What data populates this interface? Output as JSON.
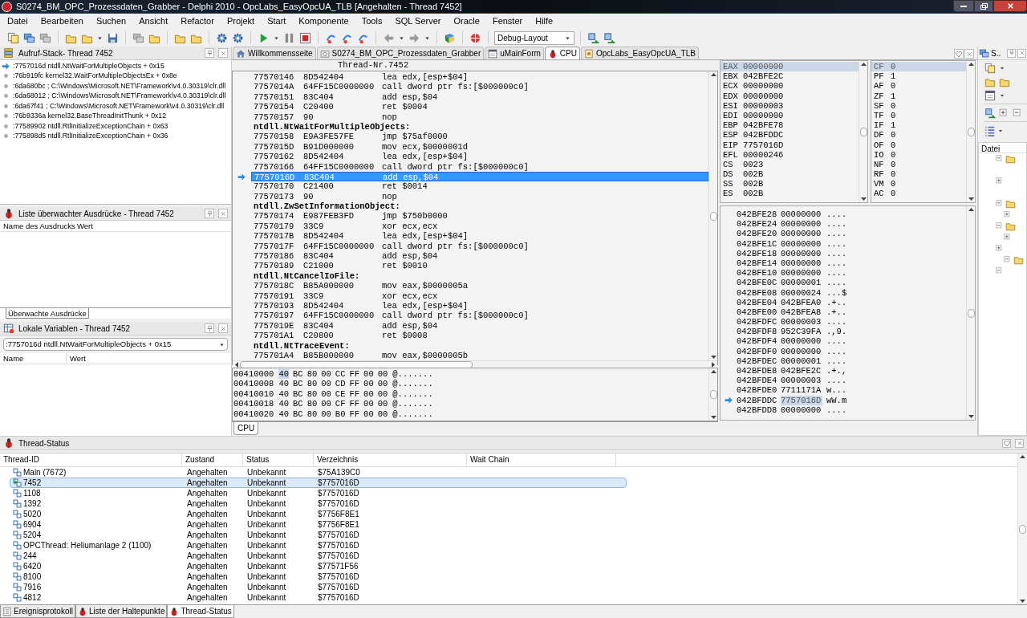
{
  "window": {
    "title": "S0274_BM_OPC_Prozessdaten_Grabber - Delphi 2010 - OpcLabs_EasyOpcUA_TLB [Angehalten - Thread 7452]"
  },
  "menu": [
    "Datei",
    "Bearbeiten",
    "Suchen",
    "Ansicht",
    "Refactor",
    "Projekt",
    "Start",
    "Komponente",
    "Tools",
    "SQL Server",
    "Oracle",
    "Fenster",
    "Hilfe"
  ],
  "toolbar": {
    "layout_select": "Debug-Layout"
  },
  "call_stack": {
    "title": "Aufruf-Stack- Thread 7452",
    "frames": [
      {
        "text": ":7757016d ntdll.NtWaitForMultipleObjects + 0x15",
        "current": true
      },
      {
        "text": ":76b919fc kernel32.WaitForMultipleObjectsEx + 0x8e",
        "current": false
      },
      {
        "text": ":6da680bc ; C:\\Windows\\Microsoft.NET\\Framework\\v4.0.30319\\clr.dll",
        "current": false
      },
      {
        "text": ":6da68012 ; C:\\Windows\\Microsoft.NET\\Framework\\v4.0.30319\\clr.dll",
        "current": false
      },
      {
        "text": ":6da67f41 ; C:\\Windows\\Microsoft.NET\\Framework\\v4.0.30319\\clr.dll",
        "current": false
      },
      {
        "text": ":76b9336a kernel32.BaseThreadInitThunk + 0x12",
        "current": false
      },
      {
        "text": ":77589902 ntdll.RtlInitializeExceptionChain + 0x63",
        "current": false
      },
      {
        "text": ":775898d5 ntdll.RtlInitializeExceptionChain + 0x36",
        "current": false
      }
    ]
  },
  "watches": {
    "title": "Liste überwachter Ausdrücke - Thread 7452",
    "columns": [
      "Name des Ausdrucks",
      "Wert"
    ],
    "tab": "Überwachte Ausdrücke"
  },
  "locals": {
    "title": "Lokale Variablen - Thread 7452",
    "frame": ":7757016d ntdll.NtWaitForMultipleObjects + 0x15",
    "columns": [
      "Name",
      "Wert"
    ]
  },
  "editor_tabs": [
    {
      "label": "Willkommensseite",
      "selected": false
    },
    {
      "label": "S0274_BM_OPC_Prozessdaten_Grabber",
      "selected": false
    },
    {
      "label": "uMainForm",
      "selected": false
    },
    {
      "label": "CPU",
      "selected": true
    },
    {
      "label": "OpcLabs_EasyOpcUA_TLB",
      "selected": false
    }
  ],
  "cpu": {
    "thread_label": "Thread-Nr.7452",
    "disassembly": [
      {
        "kind": "instr",
        "address": "77570146",
        "bytes": "8D542404",
        "asm": "lea edx,[esp+$04]",
        "current": false
      },
      {
        "kind": "instr",
        "address": "7757014A",
        "bytes": "64FF15C0000000",
        "asm": "call dword ptr fs:[$000000c0]",
        "current": false
      },
      {
        "kind": "instr",
        "address": "77570151",
        "bytes": "83C404",
        "asm": "add esp,$04",
        "current": false
      },
      {
        "kind": "instr",
        "address": "77570154",
        "bytes": "C20400",
        "asm": "ret $0004",
        "current": false
      },
      {
        "kind": "instr",
        "address": "77570157",
        "bytes": "90",
        "asm": "nop",
        "current": false
      },
      {
        "kind": "label",
        "text": "ntdll.NtWaitForMultipleObjects:"
      },
      {
        "kind": "instr",
        "address": "77570158",
        "bytes": "E9A3FE57FE",
        "asm": "jmp $75af0000",
        "current": false
      },
      {
        "kind": "instr",
        "address": "7757015D",
        "bytes": "B91D000000",
        "asm": "mov ecx,$0000001d",
        "current": false
      },
      {
        "kind": "instr",
        "address": "77570162",
        "bytes": "8D542404",
        "asm": "lea edx,[esp+$04]",
        "current": false
      },
      {
        "kind": "instr",
        "address": "77570166",
        "bytes": "64FF15C0000000",
        "asm": "call dword ptr fs:[$000000c0]",
        "current": false
      },
      {
        "kind": "instr",
        "address": "7757016D",
        "bytes": "83C404",
        "asm": "add esp,$04",
        "current": true
      },
      {
        "kind": "instr",
        "address": "77570170",
        "bytes": "C21400",
        "asm": "ret $0014",
        "current": false
      },
      {
        "kind": "instr",
        "address": "77570173",
        "bytes": "90",
        "asm": "nop",
        "current": false
      },
      {
        "kind": "label",
        "text": "ntdll.ZwSetInformationObject:"
      },
      {
        "kind": "instr",
        "address": "77570174",
        "bytes": "E987FEB3FD",
        "asm": "jmp $750b0000",
        "current": false
      },
      {
        "kind": "instr",
        "address": "77570179",
        "bytes": "33C9",
        "asm": "xor ecx,ecx",
        "current": false
      },
      {
        "kind": "instr",
        "address": "7757017B",
        "bytes": "8D542404",
        "asm": "lea edx,[esp+$04]",
        "current": false
      },
      {
        "kind": "instr",
        "address": "7757017F",
        "bytes": "64FF15C0000000",
        "asm": "call dword ptr fs:[$000000c0]",
        "current": false
      },
      {
        "kind": "instr",
        "address": "77570186",
        "bytes": "83C404",
        "asm": "add esp,$04",
        "current": false
      },
      {
        "kind": "instr",
        "address": "77570189",
        "bytes": "C21000",
        "asm": "ret $0010",
        "current": false
      },
      {
        "kind": "label",
        "text": "ntdll.NtCancelIoFile:"
      },
      {
        "kind": "instr",
        "address": "7757018C",
        "bytes": "B85A000000",
        "asm": "mov eax,$0000005a",
        "current": false
      },
      {
        "kind": "instr",
        "address": "77570191",
        "bytes": "33C9",
        "asm": "xor ecx,ecx",
        "current": false
      },
      {
        "kind": "instr",
        "address": "77570193",
        "bytes": "8D542404",
        "asm": "lea edx,[esp+$04]",
        "current": false
      },
      {
        "kind": "instr",
        "address": "77570197",
        "bytes": "64FF15C0000000",
        "asm": "call dword ptr fs:[$000000c0]",
        "current": false
      },
      {
        "kind": "instr",
        "address": "7757019E",
        "bytes": "83C404",
        "asm": "add esp,$04",
        "current": false
      },
      {
        "kind": "instr",
        "address": "775701A1",
        "bytes": "C20800",
        "asm": "ret $0008",
        "current": false
      },
      {
        "kind": "label",
        "text": "ntdll.NtTraceEvent:"
      },
      {
        "kind": "instr",
        "address": "775701A4",
        "bytes": "B85B000000",
        "asm": "mov eax,$0000005b",
        "current": false
      }
    ],
    "registers": [
      {
        "name": "EAX",
        "value": "00000000",
        "selected": true
      },
      {
        "name": "EBX",
        "value": "042BFE2C",
        "selected": false
      },
      {
        "name": "ECX",
        "value": "00000000",
        "selected": false
      },
      {
        "name": "EDX",
        "value": "00000000",
        "selected": false
      },
      {
        "name": "ESI",
        "value": "00000003",
        "selected": false
      },
      {
        "name": "EDI",
        "value": "00000000",
        "selected": false
      },
      {
        "name": "EBP",
        "value": "042BFE78",
        "selected": false
      },
      {
        "name": "ESP",
        "value": "042BFDDC",
        "selected": false
      },
      {
        "name": "EIP",
        "value": "7757016D",
        "selected": false
      },
      {
        "name": "EFL",
        "value": "00000246",
        "selected": false
      },
      {
        "name": "CS",
        "value": "0023",
        "selected": false
      },
      {
        "name": "DS",
        "value": "002B",
        "selected": false
      },
      {
        "name": "SS",
        "value": "002B",
        "selected": false
      },
      {
        "name": "ES",
        "value": "002B",
        "selected": false
      }
    ],
    "flags": [
      {
        "name": "CF",
        "value": "0",
        "selected": true
      },
      {
        "name": "PF",
        "value": "1",
        "selected": false
      },
      {
        "name": "AF",
        "value": "0",
        "selected": false
      },
      {
        "name": "ZF",
        "value": "1",
        "selected": false
      },
      {
        "name": "SF",
        "value": "0",
        "selected": false
      },
      {
        "name": "TF",
        "value": "0",
        "selected": false
      },
      {
        "name": "IF",
        "value": "1",
        "selected": false
      },
      {
        "name": "DF",
        "value": "0",
        "selected": false
      },
      {
        "name": "OF",
        "value": "0",
        "selected": false
      },
      {
        "name": "IO",
        "value": "0",
        "selected": false
      },
      {
        "name": "NF",
        "value": "0",
        "selected": false
      },
      {
        "name": "RF",
        "value": "0",
        "selected": false
      },
      {
        "name": "VM",
        "value": "0",
        "selected": false
      },
      {
        "name": "AC",
        "value": "0",
        "selected": false
      }
    ],
    "stack": [
      {
        "address": "042BFE28",
        "value": "00000000",
        "ascii": "....",
        "current": false
      },
      {
        "address": "042BFE24",
        "value": "00000000",
        "ascii": "....",
        "current": false
      },
      {
        "address": "042BFE20",
        "value": "00000000",
        "ascii": "....",
        "current": false
      },
      {
        "address": "042BFE1C",
        "value": "00000000",
        "ascii": "....",
        "current": false
      },
      {
        "address": "042BFE18",
        "value": "00000000",
        "ascii": "....",
        "current": false
      },
      {
        "address": "042BFE14",
        "value": "00000000",
        "ascii": "....",
        "current": false
      },
      {
        "address": "042BFE10",
        "value": "00000000",
        "ascii": "....",
        "current": false
      },
      {
        "address": "042BFE0C",
        "value": "00000001",
        "ascii": "....",
        "current": false
      },
      {
        "address": "042BFE08",
        "value": "00000024",
        "ascii": "...$",
        "current": false
      },
      {
        "address": "042BFE04",
        "value": "042BFEA0",
        "ascii": ".+..",
        "current": false
      },
      {
        "address": "042BFE00",
        "value": "042BFEA8",
        "ascii": ".+..",
        "current": false
      },
      {
        "address": "042BFDFC",
        "value": "00000003",
        "ascii": "....",
        "current": false
      },
      {
        "address": "042BFDF8",
        "value": "952C39FA",
        "ascii": ".,9.",
        "current": false
      },
      {
        "address": "042BFDF4",
        "value": "00000000",
        "ascii": "....",
        "current": false
      },
      {
        "address": "042BFDF0",
        "value": "00000000",
        "ascii": "....",
        "current": false
      },
      {
        "address": "042BFDEC",
        "value": "00000001",
        "ascii": "....",
        "current": false
      },
      {
        "address": "042BFDE8",
        "value": "042BFE2C",
        "ascii": ".+.,",
        "current": false
      },
      {
        "address": "042BFDE4",
        "value": "00000003",
        "ascii": "....",
        "current": false
      },
      {
        "address": "042BFDE0",
        "value": "7711171A",
        "ascii": "w...",
        "current": false
      },
      {
        "address": "042BFDDC",
        "value": "7757016D",
        "ascii": "wW.m",
        "current": true
      },
      {
        "address": "042BFDD8",
        "value": "00000000",
        "ascii": "....",
        "current": false
      }
    ],
    "memory": [
      {
        "address": "00410000",
        "bytes": [
          "40",
          "BC",
          "80",
          "00",
          "CC",
          "FF",
          "00",
          "00"
        ],
        "ascii": "@......."
      },
      {
        "address": "00410008",
        "bytes": [
          "40",
          "BC",
          "80",
          "00",
          "CD",
          "FF",
          "00",
          "00"
        ],
        "ascii": "@......."
      },
      {
        "address": "00410010",
        "bytes": [
          "40",
          "BC",
          "80",
          "00",
          "CE",
          "FF",
          "00",
          "00"
        ],
        "ascii": "@......."
      },
      {
        "address": "00410018",
        "bytes": [
          "40",
          "BC",
          "80",
          "00",
          "CF",
          "FF",
          "00",
          "00"
        ],
        "ascii": "@......."
      },
      {
        "address": "00410020",
        "bytes": [
          "40",
          "BC",
          "80",
          "00",
          "B0",
          "FF",
          "00",
          "00"
        ],
        "ascii": "@......."
      }
    ],
    "tab": "CPU"
  },
  "right_panel": {
    "title": "S..",
    "tree_header": "Datei"
  },
  "thread_status": {
    "title": "Thread-Status",
    "columns": [
      "Thread-ID",
      "Zustand",
      "Status",
      "Verzeichnis",
      "Wait Chain"
    ],
    "rows": [
      {
        "id": "Main (7672)",
        "state": "Angehalten",
        "status": "Unbekannt",
        "address": "$75A139C0",
        "selected": false
      },
      {
        "id": "7452",
        "state": "Angehalten",
        "status": "Unbekannt",
        "address": "$7757016D",
        "selected": true
      },
      {
        "id": "1108",
        "state": "Angehalten",
        "status": "Unbekannt",
        "address": "$7757016D",
        "selected": false
      },
      {
        "id": "1392",
        "state": "Angehalten",
        "status": "Unbekannt",
        "address": "$7757016D",
        "selected": false
      },
      {
        "id": "5020",
        "state": "Angehalten",
        "status": "Unbekannt",
        "address": "$7756F8E1",
        "selected": false
      },
      {
        "id": "6904",
        "state": "Angehalten",
        "status": "Unbekannt",
        "address": "$7756F8E1",
        "selected": false
      },
      {
        "id": "5204",
        "state": "Angehalten",
        "status": "Unbekannt",
        "address": "$7757016D",
        "selected": false
      },
      {
        "id": "OPCThread: Heliumanlage 2 (1100)",
        "state": "Angehalten",
        "status": "Unbekannt",
        "address": "$7757016D",
        "selected": false
      },
      {
        "id": "244",
        "state": "Angehalten",
        "status": "Unbekannt",
        "address": "$7757016D",
        "selected": false
      },
      {
        "id": "6420",
        "state": "Angehalten",
        "status": "Unbekannt",
        "address": "$77571F56",
        "selected": false
      },
      {
        "id": "8100",
        "state": "Angehalten",
        "status": "Unbekannt",
        "address": "$7757016D",
        "selected": false
      },
      {
        "id": "7916",
        "state": "Angehalten",
        "status": "Unbekannt",
        "address": "$7757016D",
        "selected": false
      },
      {
        "id": "4812",
        "state": "Angehalten",
        "status": "Unbekannt",
        "address": "$7757016D",
        "selected": false
      }
    ]
  },
  "bottom_tabs": [
    {
      "label": "Ereignisprotokoll",
      "selected": false
    },
    {
      "label": "Liste der Haltepunkte",
      "selected": false
    },
    {
      "label": "Thread-Status",
      "selected": true
    }
  ]
}
